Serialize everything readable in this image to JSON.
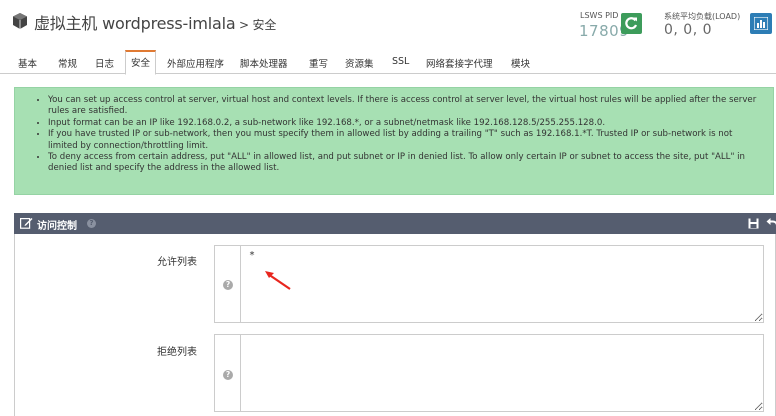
{
  "header": {
    "title": "虚拟主机 wordpress-imlala",
    "separator": " > ",
    "subtitle": "安全",
    "pid_label": "LSWS PID",
    "pid_value": "17809",
    "load_label": "系统平均负载(LOAD)",
    "load_value": "0, 0, 0"
  },
  "tabs": [
    {
      "label": "基本"
    },
    {
      "label": "常规"
    },
    {
      "label": "日志"
    },
    {
      "label": "安全"
    },
    {
      "label": "外部应用程序"
    },
    {
      "label": "脚本处理器"
    },
    {
      "label": "重写"
    },
    {
      "label": "资源集"
    },
    {
      "label": "SSL"
    },
    {
      "label": "网络套接字代理"
    },
    {
      "label": "模块"
    }
  ],
  "info_items": [
    "You can set up access control at server, virtual host and context levels. If there is access control at server level, the virtual host rules will be applied after the server rules are satisfied.",
    "Input format can be an IP like 192.168.0.2, a sub-network like 192.168.*, or a subnet/netmask like 192.168.128.5/255.255.128.0.",
    "If you have trusted IP or sub-network, then you must specify them in allowed list by adding a trailing \"T\" such as 192.168.1.*T. Trusted IP or sub-network is not limited by connection/throttling limit.",
    "To deny access from certain address, put \"ALL\" in allowed list, and put subnet or IP in denied list. To allow only certain IP or subnet to access the site, put \"ALL\" in denied list and specify the address in the allowed list."
  ],
  "panel": {
    "title": "访问控制",
    "allow_label": "允许列表",
    "allow_value": "*",
    "deny_label": "拒绝列表",
    "deny_value": ""
  },
  "colors": {
    "info_bg": "#a7e0b3",
    "panel_header": "#555d6f",
    "active_tab_accent": "#e07a33",
    "reload_button": "#3d9c5b",
    "load_button": "#2d7db5",
    "annotation_arrow": "#e8261e"
  }
}
